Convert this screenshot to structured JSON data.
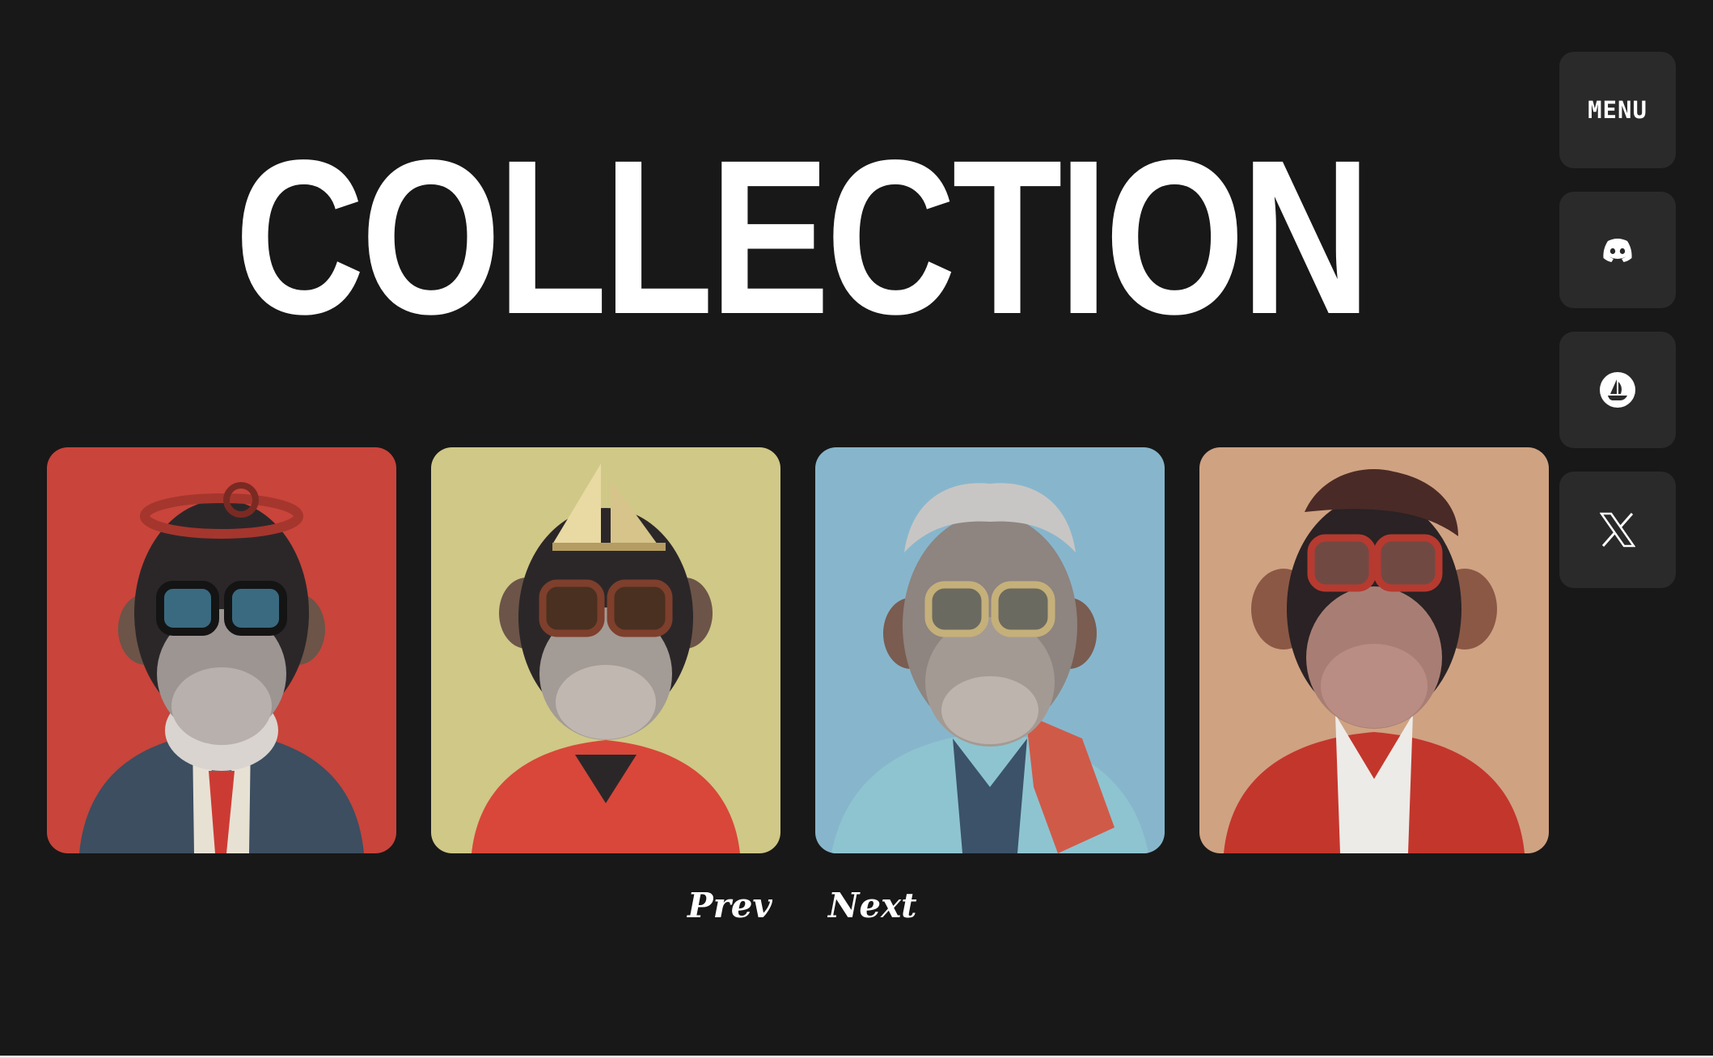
{
  "page": {
    "title": "COLLECTION"
  },
  "side_menu": {
    "menu_label": "MENU",
    "items": [
      {
        "icon": "discord-icon"
      },
      {
        "icon": "opensea-icon"
      },
      {
        "icon": "x-twitter-icon"
      }
    ]
  },
  "gallery": {
    "cards": [
      {
        "subject": "ape-portrait-red",
        "background": "#c9443b",
        "outfit": "#3c4e60"
      },
      {
        "subject": "ape-portrait-yellow",
        "background": "#cfc887",
        "outfit": "#d8473a"
      },
      {
        "subject": "ape-portrait-blue",
        "background": "#87b6cc",
        "outfit": "#8ec4d0"
      },
      {
        "subject": "ape-portrait-tan",
        "background": "#cfa282",
        "outfit": "#c3362c"
      }
    ]
  },
  "pagination": {
    "prev_label": "Prev",
    "next_label": "Next"
  },
  "colors": {
    "page_background": "#181818",
    "button_background": "#2a2a2a",
    "text": "#ffffff"
  }
}
